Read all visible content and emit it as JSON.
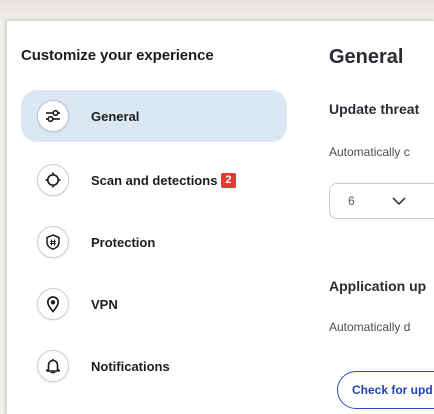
{
  "sidebar": {
    "title": "Customize your experience",
    "items": [
      {
        "label": "General",
        "icon": "sliders-icon",
        "active": true
      },
      {
        "label": "Scan and detections",
        "icon": "crosshair-icon",
        "badge": "2"
      },
      {
        "label": "Protection",
        "icon": "shield-icon"
      },
      {
        "label": "VPN",
        "icon": "location-pin-icon"
      },
      {
        "label": "Notifications",
        "icon": "bell-icon"
      }
    ]
  },
  "main": {
    "title": "General",
    "update_threat": {
      "title": "Update threat",
      "description": "Automatically c",
      "select_value": "6"
    },
    "app_updates": {
      "title": "Application up",
      "description": "Automatically d",
      "button_label": "Check for upd"
    }
  },
  "colors": {
    "active_bg": "#dbe7f5",
    "badge": "#e53935",
    "accent": "#2b50c8"
  }
}
